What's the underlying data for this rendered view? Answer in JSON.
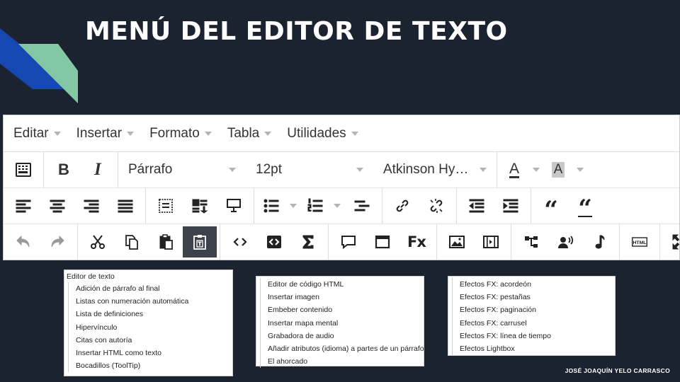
{
  "slide": {
    "title": "MENÚ DEL EDITOR DE TEXTO",
    "author": "JOSÉ JOAQUÍN YELO CARRASCO"
  },
  "colors": {
    "background": "#1b2230",
    "decoration_blue": "#1548b0",
    "decoration_green": "#83c7a4",
    "active_button": "#3c414a"
  },
  "menubar": {
    "items": [
      "Editar",
      "Insertar",
      "Formato",
      "Tabla",
      "Utilidades"
    ]
  },
  "toolbar": {
    "format_block": "Párrafo",
    "font_size": "12pt",
    "font_family": "Atkinson Hy…",
    "text_color_glyph": "A",
    "bg_color_glyph": "A"
  },
  "lists": {
    "editor_texto": {
      "heading": "Editor de texto",
      "items": [
        "Adición de párrafo al final",
        "Listas con numeración automática",
        "Lista de definiciones",
        "Hipervínculo",
        "Citas con autoría",
        "Insertar HTML como texto",
        "Bocadillos (ToolTip)"
      ]
    },
    "html": {
      "items": [
        "Editor de código HTML",
        "Insertar imagen",
        "Embeber contenido",
        "Insertar mapa mental",
        "Grabadora de audio",
        "Añadir atributos (idioma) a partes de un párrafo",
        "El ahorcado"
      ]
    },
    "efectos": {
      "items": [
        "Efectos FX: acordeón",
        "Efectos FX: pestañas",
        "Efectos FX: paginación",
        "Efectos FX: carrusel",
        "Efectos FX: línea de tiempo",
        "Efectos Lightbox"
      ]
    }
  }
}
